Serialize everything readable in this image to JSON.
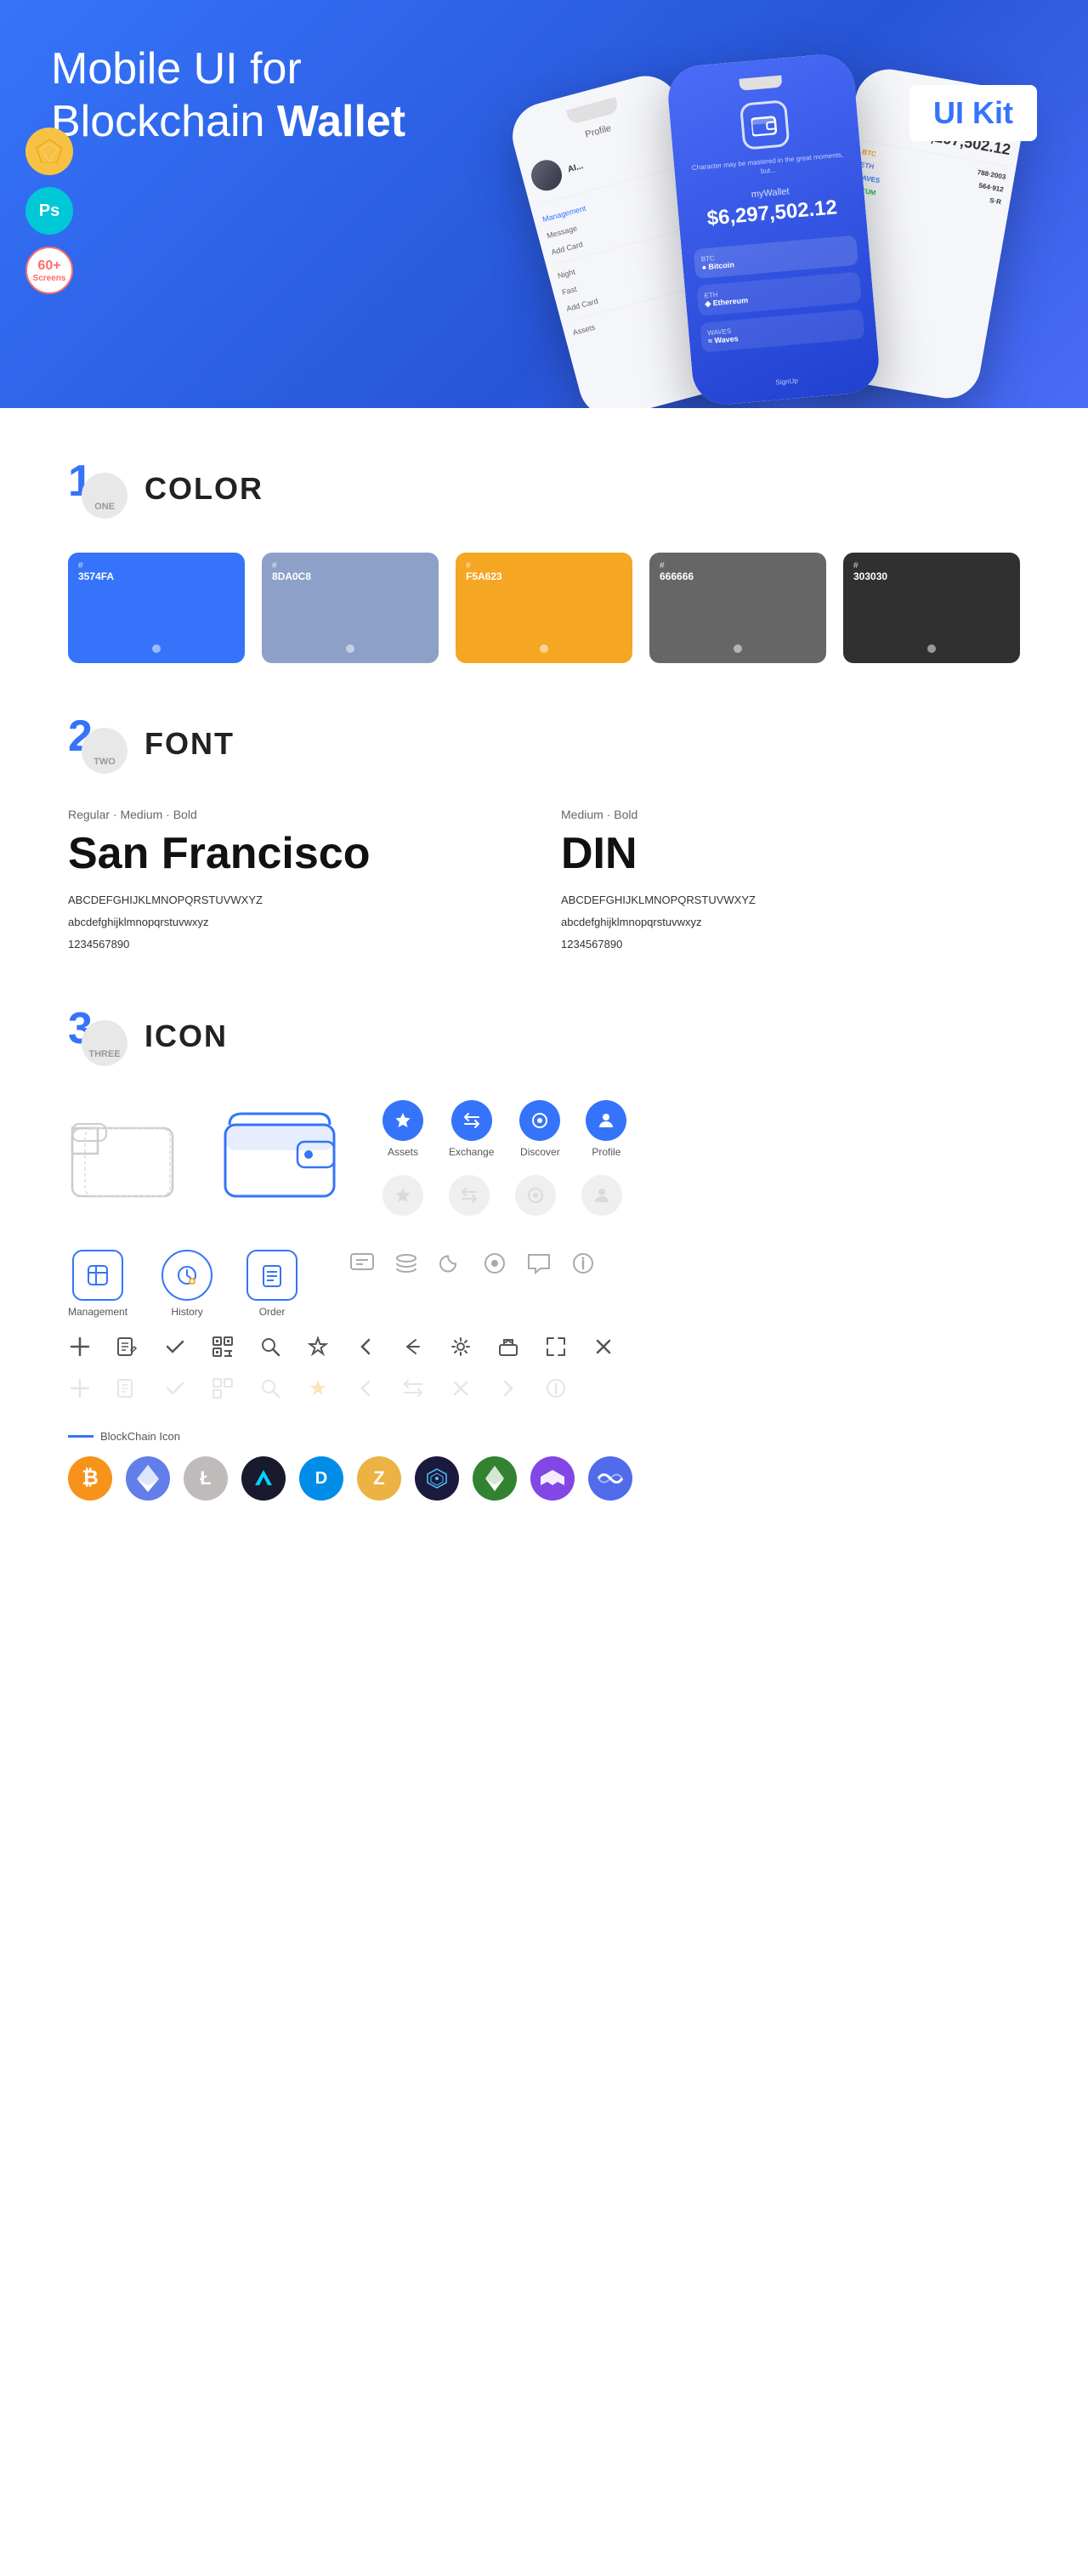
{
  "hero": {
    "title_normal": "Mobile UI for Blockchain ",
    "title_bold": "Wallet",
    "badge": "UI Kit",
    "badges": [
      {
        "type": "sketch",
        "label": "S"
      },
      {
        "type": "ps",
        "label": "Ps"
      },
      {
        "type": "screens",
        "line1": "60+",
        "line2": "Screens"
      }
    ]
  },
  "sections": {
    "color": {
      "number": "1",
      "number_label": "ONE",
      "title": "COLOR",
      "swatches": [
        {
          "hex": "#3574FA",
          "label": "#\n3574FA",
          "bg": "#3574FA"
        },
        {
          "hex": "#8DA0C8",
          "label": "#\n8DA0C8",
          "bg": "#8DA0C8"
        },
        {
          "hex": "#F5A623",
          "label": "#\nF5A623",
          "bg": "#F5A623"
        },
        {
          "hex": "#666666",
          "label": "#\n666666",
          "bg": "#666666"
        },
        {
          "hex": "#303030",
          "label": "#\n303030",
          "bg": "#303030"
        }
      ]
    },
    "font": {
      "number": "2",
      "number_label": "TWO",
      "title": "FONT",
      "fonts": [
        {
          "style": "Regular · Medium · Bold",
          "name": "San Francisco",
          "uppercase": "ABCDEFGHIJKLMNOPQRSTUVWXYZ",
          "lowercase": "abcdefghijklmnopqrstuvwxyz",
          "numbers": "1234567890"
        },
        {
          "style": "Medium · Bold",
          "name": "DIN",
          "uppercase": "ABCDEFGHIJKLMNOPQRSTUVWXYZ",
          "lowercase": "abcdefghijklmnopqrstuvwxyz",
          "numbers": "1234567890"
        }
      ]
    },
    "icon": {
      "number": "3",
      "number_label": "THREE",
      "title": "ICON",
      "nav_icons": [
        {
          "name": "Assets",
          "type": "diamond"
        },
        {
          "name": "Exchange",
          "type": "exchange"
        },
        {
          "name": "Discover",
          "type": "discover"
        },
        {
          "name": "Profile",
          "type": "profile"
        }
      ],
      "action_icons": [
        {
          "name": "Management",
          "type": "management"
        },
        {
          "name": "History",
          "type": "history"
        },
        {
          "name": "Order",
          "type": "order"
        }
      ],
      "misc_icons_row1": [
        "chat",
        "layers",
        "moon",
        "circle",
        "chat-bubble",
        "info"
      ],
      "tool_icons": [
        "+",
        "list-edit",
        "check",
        "qr",
        "search",
        "star",
        "<",
        "share",
        "gear",
        "box",
        "expand",
        "x"
      ],
      "blockchain_label": "BlockChain Icon",
      "crypto_coins": [
        "BTC",
        "ETH",
        "LTC",
        "WINGS",
        "DASH",
        "ZEC",
        "GRID",
        "ETC",
        "MATIC",
        "BAND"
      ]
    }
  }
}
